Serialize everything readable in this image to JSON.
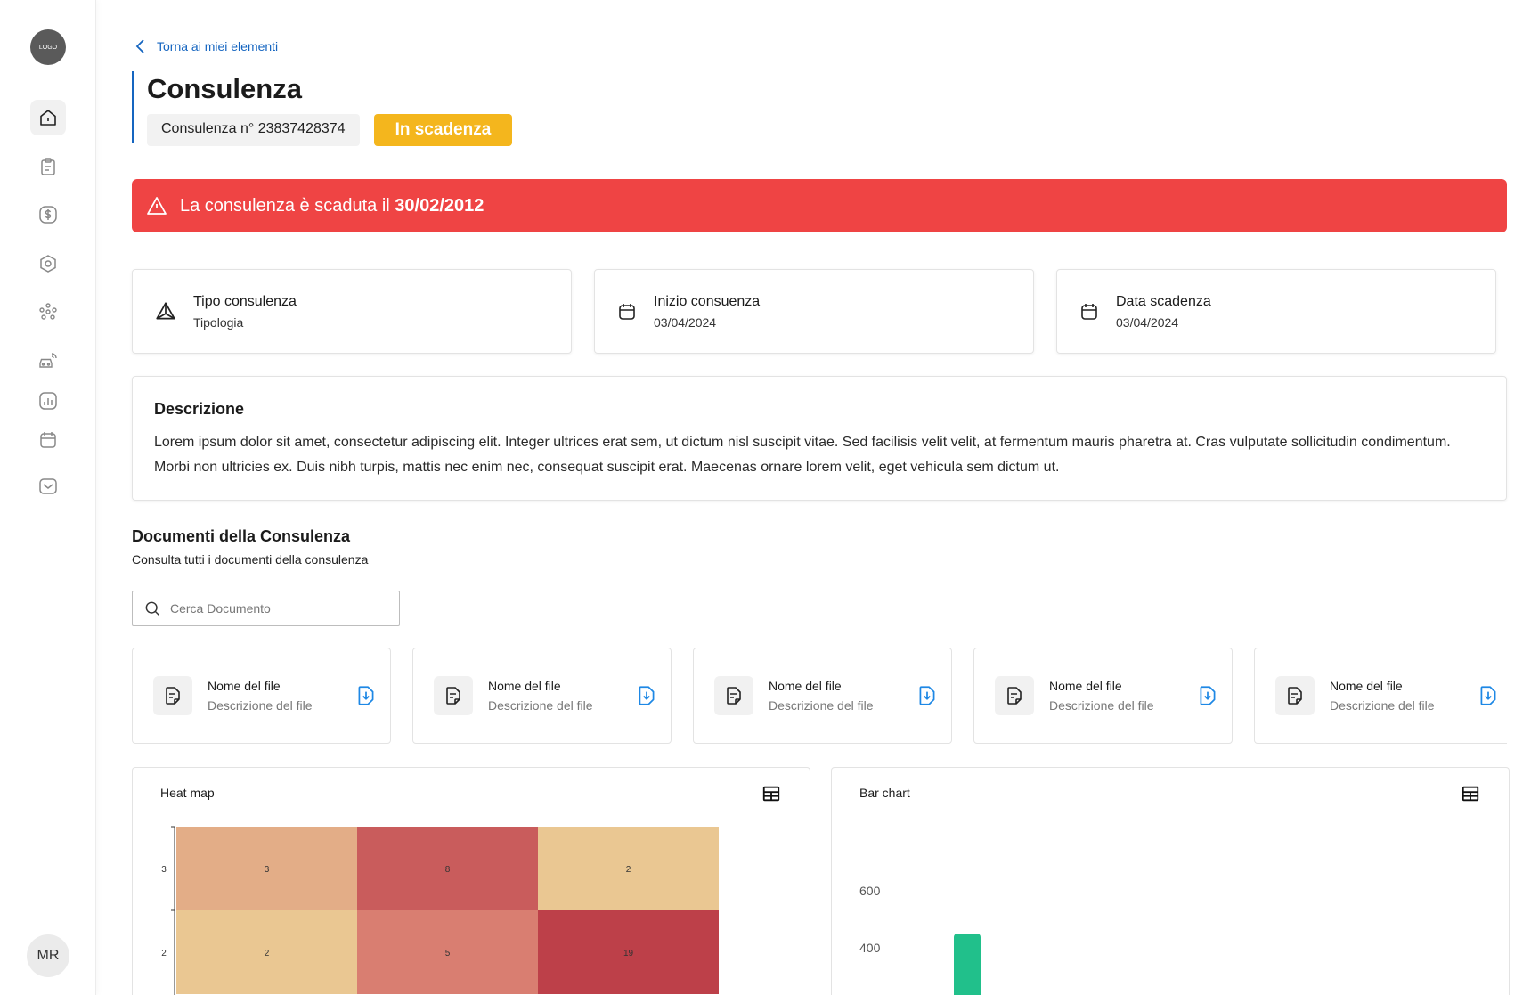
{
  "sidebar": {
    "logo_label": "LOGO",
    "nav": [
      {
        "icon": "home-icon",
        "active": true
      },
      {
        "icon": "clipboard-icon",
        "active": false
      },
      {
        "icon": "dollar-icon",
        "active": false
      },
      {
        "icon": "hexagon-settings-icon",
        "active": false
      },
      {
        "icon": "people-group-icon",
        "active": false
      },
      {
        "icon": "car-connected-icon",
        "active": false
      },
      {
        "icon": "analytics-icon",
        "active": false
      },
      {
        "icon": "calendar-icon",
        "active": false
      },
      {
        "icon": "inbox-icon",
        "active": false
      }
    ],
    "user_initials": "MR"
  },
  "header": {
    "back_label": "Torna ai miei elementi",
    "title": "Consulenza",
    "id_chip": "Consulenza n° 23837428374",
    "status_chip": "In scadenza"
  },
  "alert": {
    "text": "La consulenza è scaduta il ",
    "date": "30/02/2012"
  },
  "info_cards": [
    {
      "icon": "prism-icon",
      "title": "Tipo consulenza",
      "value": "Tipologia"
    },
    {
      "icon": "calendar-icon",
      "title": "Inizio consuenza",
      "value": "03/04/2024"
    },
    {
      "icon": "calendar-icon",
      "title": "Data scadenza",
      "value": "03/04/2024"
    }
  ],
  "description": {
    "title": "Descrizione",
    "text": "Lorem ipsum dolor sit amet, consectetur adipiscing elit. Integer ultrices erat sem, ut dictum nisl suscipit vitae. Sed facilisis velit velit, at fermentum mauris pharetra at. Cras vulputate sollicitudin condimentum. Morbi non ultricies ex. Duis nibh turpis, mattis nec enim nec, consequat suscipit erat. Maecenas ornare lorem velit, eget vehicula sem dictum ut."
  },
  "documents": {
    "title": "Documenti della Consulenza",
    "subtitle": "Consulta tutti i documenti della consulenza",
    "search_placeholder": "Cerca Documento",
    "files": [
      {
        "name": "Nome del file",
        "desc": "Descrizione del file"
      },
      {
        "name": "Nome del file",
        "desc": "Descrizione del file"
      },
      {
        "name": "Nome del file",
        "desc": "Descrizione del file"
      },
      {
        "name": "Nome del file",
        "desc": "Descrizione del file"
      },
      {
        "name": "Nome del file",
        "desc": "Descrizione del file"
      }
    ]
  },
  "colors": {
    "accent": "#1565c0",
    "status_warning": "#f4b61d",
    "alert_red": "#ef4444",
    "bar_green": "#21c08b"
  },
  "chart_data": [
    {
      "type": "heatmap",
      "title": "Heat map",
      "y_labels": [
        "3",
        "2"
      ],
      "cells": [
        [
          3,
          8,
          2
        ],
        [
          2,
          5,
          19
        ]
      ],
      "cell_colors": [
        [
          "#e3ad87",
          "#c95c5c",
          "#eac792"
        ],
        [
          "#eac792",
          "#d97e71",
          "#bd4049"
        ]
      ]
    },
    {
      "type": "bar",
      "title": "Bar chart",
      "y_ticks": [
        "600",
        "400"
      ],
      "values": [
        450
      ]
    }
  ]
}
